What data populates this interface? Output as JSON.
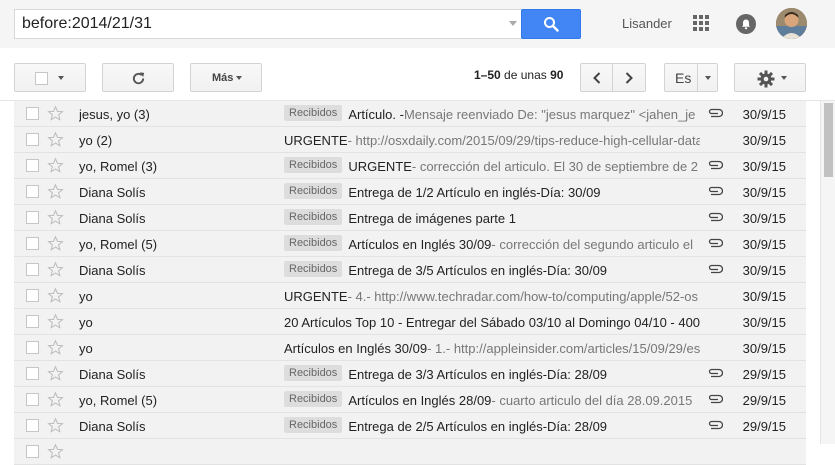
{
  "search": {
    "query": "before:2014/21/31"
  },
  "header": {
    "user_name": "Lisander"
  },
  "toolbar": {
    "more_label": "Más",
    "pager": {
      "range": "1–50",
      "of_text": "de unas",
      "total": "90"
    },
    "language": "Es"
  },
  "icons": {
    "search": "search-icon",
    "apps": "apps-grid-icon",
    "notifications": "notifications-icon",
    "refresh": "refresh-icon",
    "settings": "gear-icon",
    "attachment": "paperclip-icon",
    "star": "star-icon"
  },
  "colors": {
    "search_button": "#4285f4",
    "unread_bg": "#ffffff",
    "read_bg": "#f2f2f2",
    "label_chip": "#dddddd"
  },
  "rows": [
    {
      "sender": "jesus, yo (3)",
      "label": "Recibidos",
      "subject": "Artículo. - ",
      "snippet": "Mensaje reenviado De: \"jesus marquez\" <jahen_je",
      "attachment": true,
      "date": "30/9/15",
      "unread": false
    },
    {
      "sender": "yo (2)",
      "label": "",
      "subject": "URGENTE",
      "snippet": " - http://osxdaily.com/2015/09/29/tips-reduce-high-cellular-data",
      "attachment": false,
      "date": "30/9/15",
      "unread": false
    },
    {
      "sender": "yo, Romel (3)",
      "label": "Recibidos",
      "subject": "URGENTE",
      "snippet": " - corrección del articulo. El 30 de septiembre de 2",
      "attachment": true,
      "date": "30/9/15",
      "unread": false
    },
    {
      "sender": "Diana Solís",
      "label": "Recibidos",
      "subject": "Entrega de 1/2 Artículo en inglés-Día: 30/09",
      "snippet": "",
      "attachment": true,
      "date": "30/9/15",
      "unread": false
    },
    {
      "sender": "Diana Solís",
      "label": "Recibidos",
      "subject": "Entrega de imágenes parte 1",
      "snippet": "",
      "attachment": true,
      "date": "30/9/15",
      "unread": false
    },
    {
      "sender": "yo, Romel (5)",
      "label": "Recibidos",
      "subject": "Artículos en Inglés 30/09",
      "snippet": " - corrección del segundo articulo el",
      "attachment": true,
      "date": "30/9/15",
      "unread": false
    },
    {
      "sender": "Diana Solís",
      "label": "Recibidos",
      "subject": "Entrega de 3/5 Artículos en inglés-Día: 30/09",
      "snippet": "",
      "attachment": true,
      "date": "30/9/15",
      "unread": false
    },
    {
      "sender": "yo",
      "label": "",
      "subject": "URGENTE",
      "snippet": " - 4.- http://www.techradar.com/how-to/computing/apple/52-os",
      "attachment": false,
      "date": "30/9/15",
      "unread": false
    },
    {
      "sender": "yo",
      "label": "",
      "subject": "20 Artículos Top 10 - Entregar del Sábado 03/10 al Domingo 04/10 - 400",
      "snippet": "",
      "attachment": false,
      "date": "30/9/15",
      "unread": false
    },
    {
      "sender": "yo",
      "label": "",
      "subject": "Artículos en Inglés 30/09",
      "snippet": " - 1.- http://appleinsider.com/articles/15/09/29/es",
      "attachment": false,
      "date": "30/9/15",
      "unread": false
    },
    {
      "sender": "Diana Solís",
      "label": "Recibidos",
      "subject": "Entrega de 3/3 Artículos en inglés-Día: 28/09",
      "snippet": "",
      "attachment": true,
      "date": "29/9/15",
      "unread": false
    },
    {
      "sender": "yo, Romel (5)",
      "label": "Recibidos",
      "subject": "Artículos en Inglés 28/09",
      "snippet": " - cuarto articulo del día 28.09.2015",
      "attachment": true,
      "date": "29/9/15",
      "unread": false
    },
    {
      "sender": "Diana Solís",
      "label": "Recibidos",
      "subject": "Entrega de 2/5 Artículos en inglés-Día: 28/09",
      "snippet": "",
      "attachment": true,
      "date": "29/9/15",
      "unread": false
    },
    {
      "sender": "",
      "label": "",
      "subject": "",
      "snippet": "",
      "attachment": false,
      "date": "",
      "unread": false
    }
  ]
}
